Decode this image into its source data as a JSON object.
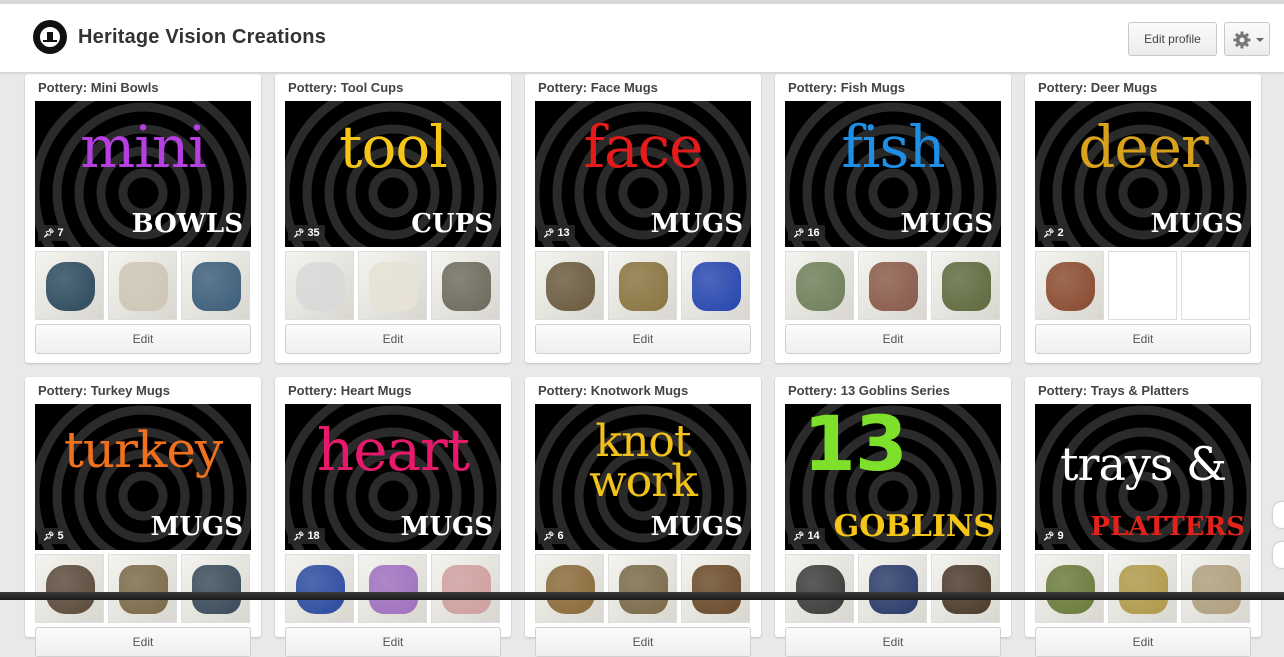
{
  "header": {
    "site_title": "Heritage Vision Creations",
    "edit_profile_label": "Edit profile"
  },
  "common": {
    "edit_label": "Edit"
  },
  "boards": [
    {
      "title": "Pottery: Mini Bowls",
      "cover_big": "mini",
      "cover_small": "BOWLS",
      "big_color": "#b53fe0",
      "count": "7"
    },
    {
      "title": "Pottery: Tool Cups",
      "cover_big": "tool",
      "cover_small": "CUPS",
      "big_color": "#f5c518",
      "count": "35"
    },
    {
      "title": "Pottery: Face Mugs",
      "cover_big": "face",
      "cover_small": "MUGS",
      "big_color": "#e51b1b",
      "count": "13"
    },
    {
      "title": "Pottery: Fish Mugs",
      "cover_big": "fish",
      "cover_small": "MUGS",
      "big_color": "#1e8fe6",
      "count": "16"
    },
    {
      "title": "Pottery: Deer Mugs",
      "cover_big": "deer",
      "cover_small": "MUGS",
      "big_color": "#d9a21b",
      "count": "2"
    },
    {
      "title": "Pottery: Turkey Mugs",
      "cover_big": "turkey",
      "cover_small": "MUGS",
      "big_color": "#f0701e",
      "count": "5"
    },
    {
      "title": "Pottery: Heart Mugs",
      "cover_big": "heart",
      "cover_small": "MUGS",
      "big_color": "#e8196b",
      "count": "18"
    },
    {
      "title": "Pottery: Knotwork Mugs",
      "cover_big": "knot work",
      "cover_small": "MUGS",
      "big_color": "#f2c21a",
      "count": "6"
    },
    {
      "title": "Pottery: 13 Goblins Series",
      "cover_big": "13",
      "cover_small": "GOBLINS",
      "big_color": "#7ee02a",
      "count": "14"
    },
    {
      "title": "Pottery: Trays & Platters",
      "cover_big": "trays &",
      "cover_small": "PLATTERS",
      "big_color": "#ffffff",
      "count": "9"
    }
  ]
}
